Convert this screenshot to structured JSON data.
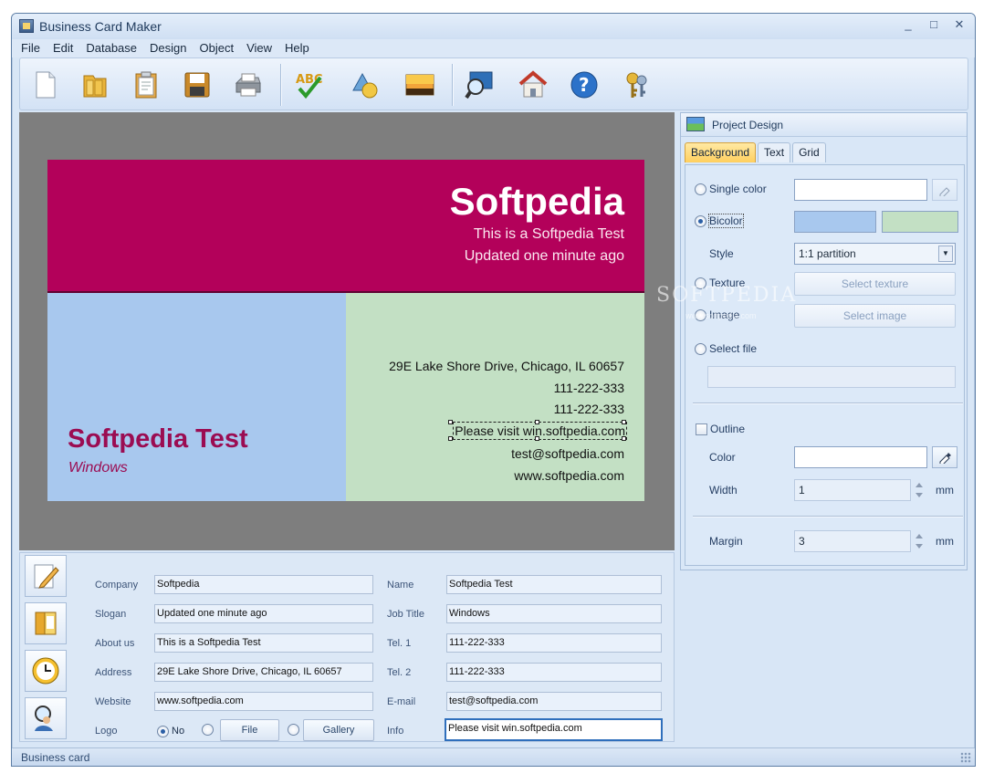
{
  "window": {
    "title": "Business Card Maker",
    "controls": [
      "_",
      "□",
      "✕"
    ]
  },
  "menu": [
    "File",
    "Edit",
    "Database",
    "Design",
    "Object",
    "View",
    "Help"
  ],
  "toolbar": [
    "new-icon",
    "open-folder-icon",
    "paste-icon",
    "save-icon",
    "print-icon",
    "spellcheck-icon",
    "shapes-icon",
    "image-icon",
    "zoom-icon",
    "home-icon",
    "help-icon",
    "keys-icon"
  ],
  "card": {
    "company": "Softpedia",
    "about": "This is a Softpedia Test",
    "slogan": "Updated one minute ago",
    "name": "Softpedia Test",
    "job": "Windows",
    "address": "29E Lake Shore Drive, Chicago, IL 60657",
    "tel1": "111-222-333",
    "tel2": "111-222-333",
    "info": "Please visit win.softpedia.com",
    "email": "test@softpedia.com",
    "website": "www.softpedia.com",
    "colors": {
      "top": "#b3015a",
      "left": "#a8c8ee",
      "right": "#c3e0c4"
    }
  },
  "watermark": {
    "main": "SOFTPEDIA",
    "sub": "www.softpedia.com"
  },
  "form": {
    "labels": {
      "company": "Company",
      "slogan": "Slogan",
      "about": "About us",
      "address": "Address",
      "website": "Website",
      "logo": "Logo",
      "name": "Name",
      "job": "Job Title",
      "tel1": "Tel. 1",
      "tel2": "Tel. 2",
      "email": "E-mail",
      "info": "Info"
    },
    "values": {
      "company": "Softpedia",
      "slogan": "Updated one minute ago",
      "about": "This is a Softpedia Test",
      "address": "29E Lake Shore Drive, Chicago, IL 60657",
      "website": "www.softpedia.com",
      "name": "Softpedia Test",
      "job": "Windows",
      "tel1": "111-222-333",
      "tel2": "111-222-333",
      "email": "test@softpedia.com",
      "info": "Please visit win.softpedia.com"
    },
    "logo_no": "No",
    "logo_file": "File",
    "logo_gallery": "Gallery"
  },
  "project_design": {
    "title": "Project Design",
    "tabs": [
      "Background",
      "Text",
      "Grid"
    ],
    "single_color": "Single color",
    "bicolor": "Bicolor",
    "style_label": "Style",
    "style_value": "1:1 partition",
    "texture": "Texture",
    "select_texture": "Select texture",
    "image": "Image",
    "select_image": "Select image",
    "select_file": "Select file",
    "outline": "Outline",
    "color": "Color",
    "width_label": "Width",
    "width_value": "1",
    "unit": "mm",
    "margin_label": "Margin",
    "margin_value": "3",
    "swatch1": "#a8c8ee",
    "swatch2": "#c3e0c4"
  },
  "status": "Business card"
}
